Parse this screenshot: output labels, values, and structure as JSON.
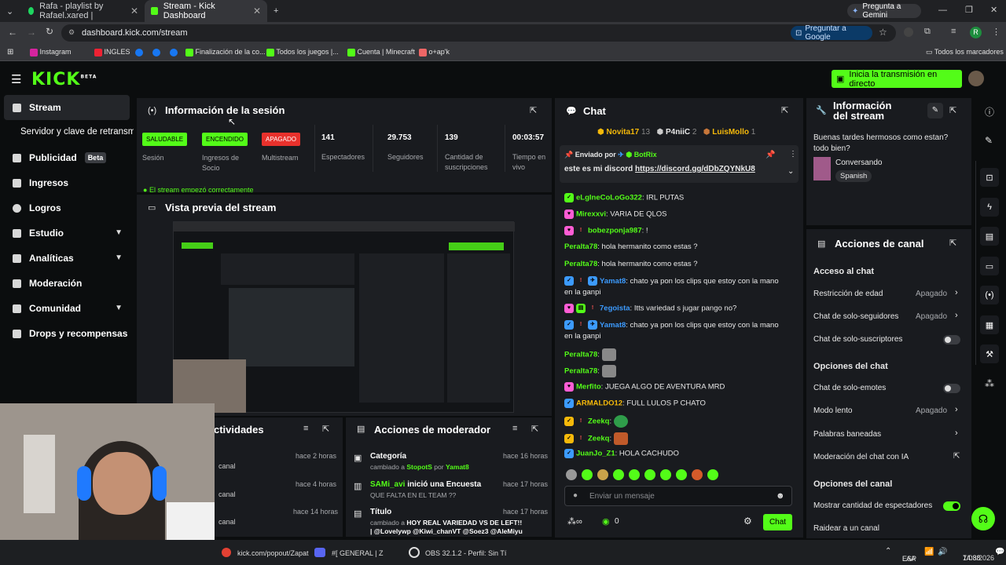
{
  "browser": {
    "tabs": [
      {
        "label": "Rafa - playlist by Rafael.xared |"
      },
      {
        "label": "Stream - Kick Dashboard"
      }
    ],
    "gemini": "Pregunta a Gemini",
    "url": "dashboard.kick.com/stream",
    "ask_google": "Preguntar a Google",
    "avatar": "R",
    "bookmarks": [
      "Instagram",
      "INGLES",
      "Finalización de la co...",
      "Todos los juegos |...",
      "Cuenta | Minecraft",
      "o+ap'k"
    ],
    "all_bookmarks": "Todos los marcadores"
  },
  "header": {
    "logo": "KICK",
    "beta": "BETA",
    "go_live": "Inicia la transmisión en directo"
  },
  "sidebar": {
    "items": [
      {
        "label": "Stream"
      },
      {
        "label": "Servidor y clave de retransmi"
      },
      {
        "label": "Publicidad"
      },
      {
        "label": "Ingresos"
      },
      {
        "label": "Logros"
      },
      {
        "label": "Estudio"
      },
      {
        "label": "Analíticas"
      },
      {
        "label": "Moderación"
      },
      {
        "label": "Comunidad"
      },
      {
        "label": "Drops y recompensas"
      }
    ],
    "beta_badge": "Beta"
  },
  "session": {
    "title": "Información de la sesión",
    "stats": [
      {
        "badge": "SALUDABLE",
        "label": "Sesión"
      },
      {
        "badge": "ENCENDIDO",
        "label": "Ingresos de Socio"
      },
      {
        "badge": "APAGADO",
        "label": "Multistream"
      },
      {
        "value": "141",
        "label": "Espectadores"
      },
      {
        "value": "29.753",
        "label": "Seguidores"
      },
      {
        "value": "139",
        "label": "Cantidad de suscripciones"
      },
      {
        "value": "00:03:57",
        "label": "Tiempo en vivo"
      }
    ],
    "note": "El stream empezó correctamente"
  },
  "preview": {
    "title": "Vista previa del stream"
  },
  "activity": {
    "title": "ctividades",
    "items": [
      {
        "time": "hace 2 horas",
        "text": "canal"
      },
      {
        "time": "hace 4 horas",
        "text": "canal"
      },
      {
        "time": "hace 14 horas",
        "text": "canal"
      }
    ]
  },
  "modactions": {
    "title": "Acciones de moderador",
    "items": [
      {
        "title": "Categoría",
        "time": "hace 16 horas",
        "sub": "cambiado a",
        "target": "StopotS",
        "by": "por",
        "who": "Yamat8"
      },
      {
        "title": "SAMi_avi",
        "title2": "inició una Encuesta",
        "time": "hace 17 horas",
        "sub": "QUE FALTA EN EL TEAM ??"
      },
      {
        "title": "Título",
        "time": "hace 17 horas",
        "sub": "cambiado a",
        "target": "HOY REAL VARIEDAD VS DE LEFT!! | @Lovelywp @Kiwi_chanVT @Soez3 @AleMiyu"
      }
    ]
  },
  "chat": {
    "title": "Chat",
    "top": [
      {
        "name": "Novita17",
        "n": "13"
      },
      {
        "name": "P4niiC",
        "n": "2"
      },
      {
        "name": "LuisMollo",
        "n": "1"
      }
    ],
    "pinned": {
      "by": "Enviado por",
      "who": "BotRix",
      "text": "este es mi discord",
      "link": "https://discord.gg/dDbZQYNkU8"
    },
    "messages": [
      {
        "user": "eLgIneCoLoGo322",
        "text": ": IRL PUTAS",
        "color": "#53fc18"
      },
      {
        "user": "Mirexxvi",
        "text": ": VARIA DE QLOS",
        "color": "#53fc18"
      },
      {
        "user": "bobezponja987",
        "text": ": !",
        "color": "#53fc18"
      },
      {
        "user": "Peralta78",
        "text": ": hola hermanito como estas ?",
        "color": "#53fc18"
      },
      {
        "user": "Peralta78",
        "text": ": hola hermanito como estas ?",
        "color": "#53fc18"
      },
      {
        "user": "Yamat8",
        "text": ": chato ya pon los clips que estoy con la mano",
        "text2": "en la ganpi",
        "color": "#3c9bff"
      },
      {
        "user": "7egoista",
        "text": ": Itts variedad s jugar pango no?",
        "color": "#3c9bff"
      },
      {
        "user": "Yamat8",
        "text": ": chato ya pon los clips que estoy con la mano",
        "text2": "en la ganpi",
        "color": "#3c9bff"
      },
      {
        "user": "Peralta78",
        "text": ":",
        "color": "#53fc18"
      },
      {
        "user": "Peralta78",
        "text": ":",
        "color": "#53fc18"
      },
      {
        "user": "Merfito",
        "text": ": JUEGA ALGO DE AVENTURA MRD",
        "color": "#53fc18"
      },
      {
        "user": "ARMALDO12",
        "text": ": FULL LULOS P CHATO",
        "color": "#f5b90a"
      },
      {
        "user": "Zeekq",
        "text": ":",
        "color": "#53fc18"
      },
      {
        "user": "Zeekq",
        "text": ":",
        "color": "#53fc18"
      },
      {
        "user": "JuanJo_Z1",
        "text": ": HOLA CACHUDO",
        "color": "#53fc18"
      }
    ],
    "placeholder": "Enviar un mensaje",
    "points": "0",
    "send": "Chat"
  },
  "streaminfo": {
    "title": "Información del stream",
    "desc": "Buenas tardes hermosos como estan? todo bien?",
    "category": "Conversando",
    "tag": "Spanish"
  },
  "channel": {
    "title": "Acciones de canal",
    "access": "Acceso al chat",
    "age": "Restricción de edad",
    "age_val": "Apagado",
    "followers": "Chat de solo-seguidores",
    "followers_val": "Apagado",
    "subs": "Chat de solo-suscriptores",
    "chat_opts": "Opciones del chat",
    "emotes": "Chat de solo-emotes",
    "slow": "Modo lento",
    "slow_val": "Apagado",
    "banned": "Palabras baneadas",
    "ai": "Moderación del chat con IA",
    "channel_opts": "Opciones del canal",
    "viewers": "Mostrar cantidad de espectadores",
    "raid": "Raidear a un canal"
  },
  "taskbar": {
    "items": [
      "kick.com/popout/Zapat",
      "#[ GENERAL  | Z",
      "OBS 32.1.2 - Perfil: Sin Tí"
    ],
    "lang": "ESP",
    "lang2": "LAA",
    "time": "14:38",
    "date": "7/08/2026"
  }
}
